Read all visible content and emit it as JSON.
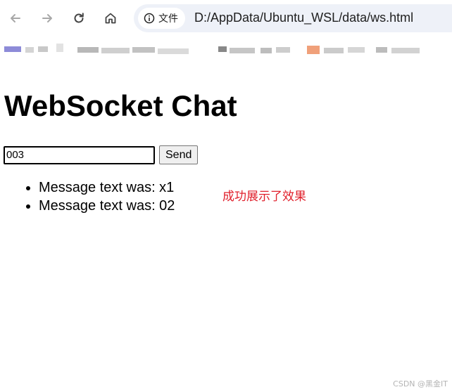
{
  "browser": {
    "site_info_label": "文件",
    "url": "D:/AppData/Ubuntu_WSL/data/ws.html"
  },
  "page": {
    "title": "WebSocket Chat",
    "input_value": "003",
    "send_label": "Send",
    "messages": [
      "Message text was: x1",
      "Message text was: 02"
    ]
  },
  "annotation": "成功展示了效果",
  "watermark": "CSDN @黑金IT",
  "colors": {
    "annotation": "#e0202c",
    "omnibox_bg": "#eef1f8"
  }
}
